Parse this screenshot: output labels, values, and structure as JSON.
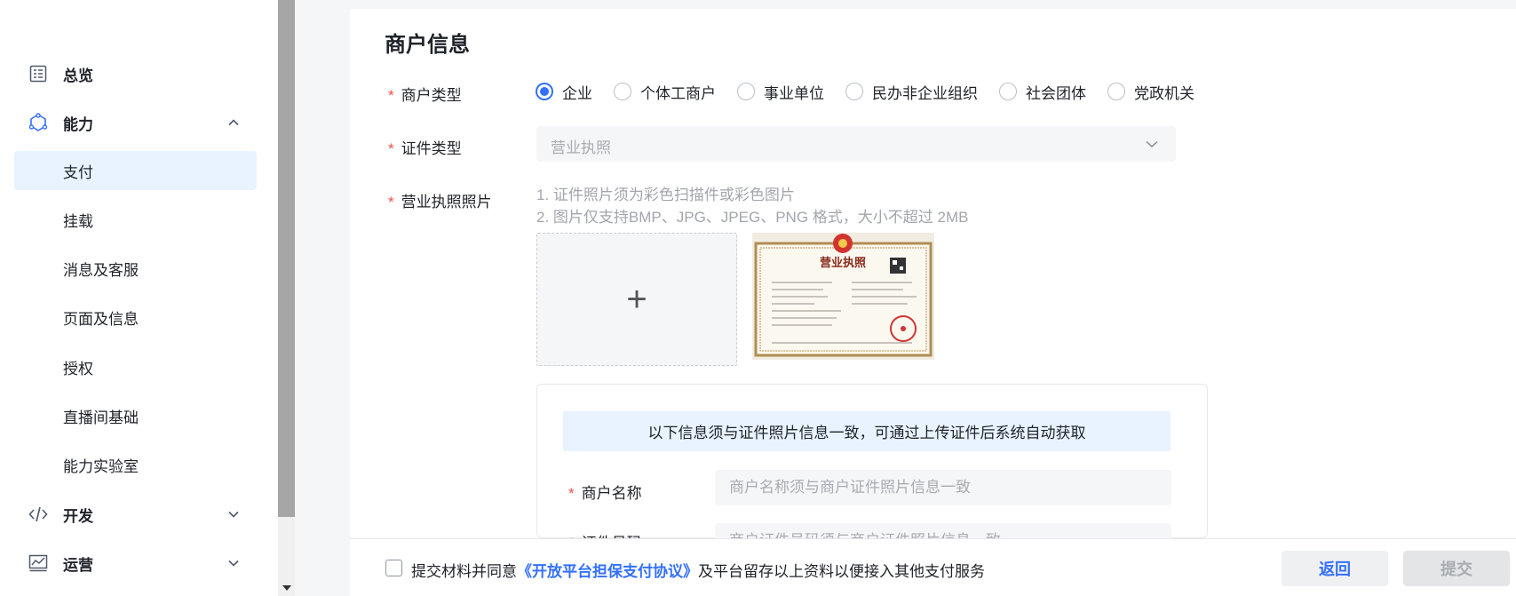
{
  "sidebar": {
    "overview": {
      "label": "总览",
      "icon": "dashboard-icon"
    },
    "ability": {
      "label": "能力",
      "icon": "ability-icon",
      "expanded": true
    },
    "ability_items": [
      {
        "label": "支付",
        "active": true
      },
      {
        "label": "挂载"
      },
      {
        "label": "消息及客服"
      },
      {
        "label": "页面及信息"
      },
      {
        "label": "授权"
      },
      {
        "label": "直播间基础"
      },
      {
        "label": "能力实验室"
      }
    ],
    "develop": {
      "label": "开发",
      "icon": "code-icon"
    },
    "operate": {
      "label": "运营",
      "icon": "chart-icon"
    }
  },
  "main": {
    "section_title": "商户信息",
    "merchant_type": {
      "label": "商户类型",
      "options": [
        "企业",
        "个体工商户",
        "事业单位",
        "民办非企业组织",
        "社会团体",
        "党政机关"
      ],
      "selected": "企业"
    },
    "cert_type": {
      "label": "证件类型",
      "value": "营业执照"
    },
    "license_photo": {
      "label": "营业执照照片",
      "hint1": "1. 证件照片须为彩色扫描件或彩色图片",
      "hint2": "2. 图片仅支持BMP、JPG、JPEG、PNG 格式，大小不超过 2MB",
      "upload_symbol": "+",
      "thumbnail_title": "营业执照"
    },
    "info_banner": "以下信息须与证件照片信息一致，可通过上传证件后系统自动获取",
    "merchant_name": {
      "label": "商户名称",
      "placeholder": "商户名称须与商户证件照片信息一致"
    },
    "cert_number": {
      "label": "证件号码",
      "placeholder": "商户证件号码须与商户证件照片信息一致"
    }
  },
  "footer": {
    "agree_prefix": "提交材料并同意",
    "agree_link": "《开放平台担保支付协议》",
    "agree_suffix": "及平台留存以上资料以便接入其他支付服务",
    "back_label": "返回",
    "submit_label": "提交"
  },
  "colors": {
    "accent": "#3370ff",
    "required": "#f54a45",
    "active_bg": "#e8f3ff"
  }
}
